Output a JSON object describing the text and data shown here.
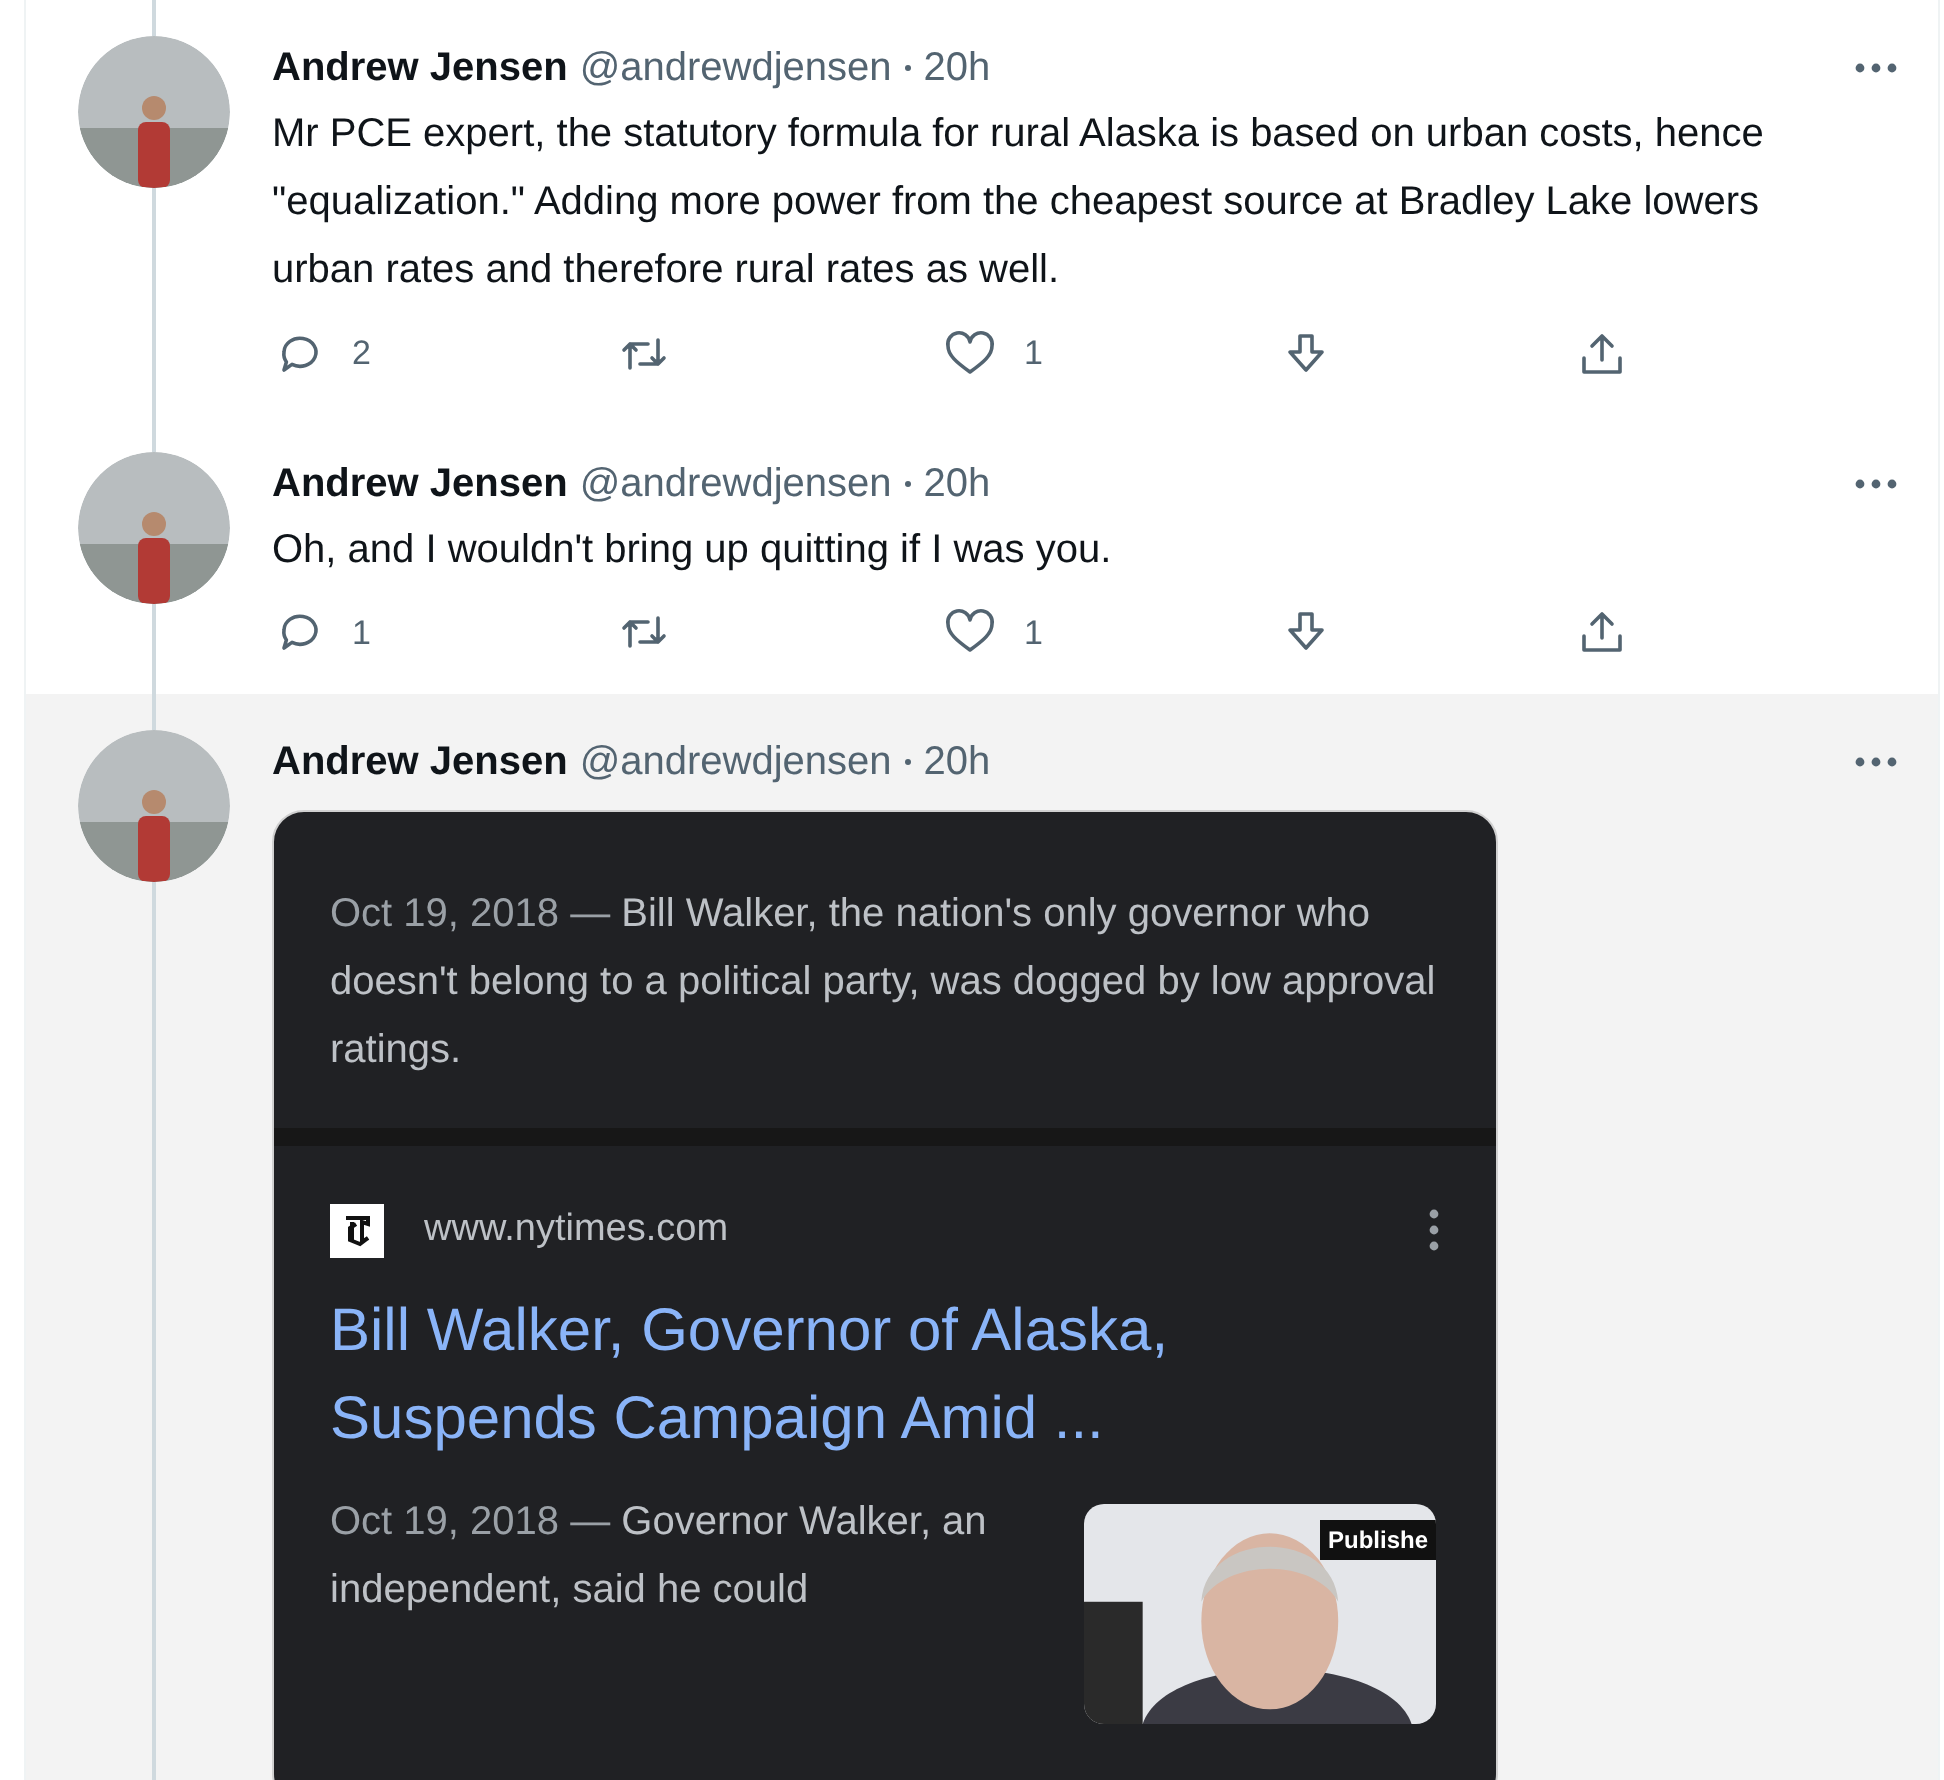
{
  "tweets": [
    {
      "author": "Andrew Jensen",
      "handle": "@andrewdjensen",
      "time": "20h",
      "highlighted": false,
      "text": "Mr PCE expert, the statutory formula for rural Alaska is based on urban costs, hence \"equalization.\" Adding more power from the cheapest source at Bradley Lake lowers urban rates and therefore rural rates as well.",
      "actions": {
        "replies": "2",
        "likes": "1"
      }
    },
    {
      "author": "Andrew Jensen",
      "handle": "@andrewdjensen",
      "time": "20h",
      "highlighted": false,
      "text": "Oh, and I wouldn't bring up quitting if I was you.",
      "actions": {
        "replies": "1",
        "likes": "1"
      }
    },
    {
      "author": "Andrew Jensen",
      "handle": "@andrewdjensen",
      "time": "20h",
      "highlighted": true,
      "media": {
        "results": [
          {
            "kind": "snippet",
            "date": "Oct 19, 2018 —",
            "snippet": "Bill Walker, the nation's only governor who doesn't belong to a political party, was dogged by low approval ratings."
          },
          {
            "kind": "result",
            "site": "www.nytimes.com",
            "title": "Bill Walker, Governor of Alaska, Suspends Campaign Amid ...",
            "date": "Oct 19, 2018 —",
            "snippet": "Governor Walker, an independent, said he could",
            "thumbnail_badge": "Publishe"
          }
        ]
      }
    }
  ]
}
